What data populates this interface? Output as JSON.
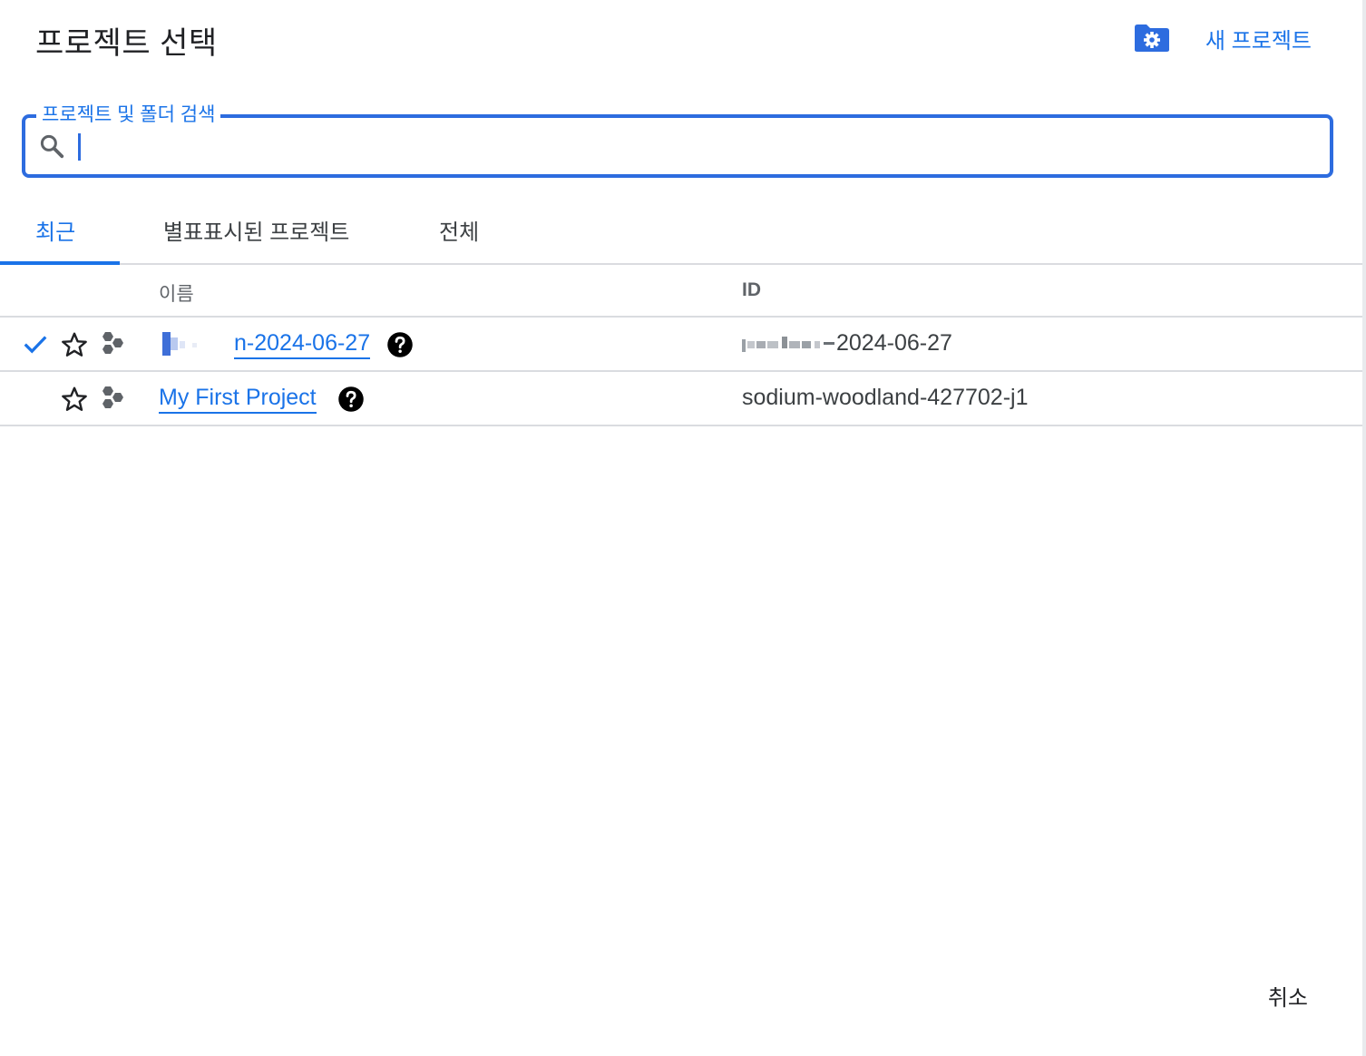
{
  "dialog": {
    "title": "프로젝트 선택",
    "folder_settings_icon": "folder-gear-icon",
    "new_project_label": "새 프로젝트"
  },
  "search": {
    "label": "프로젝트 및 폴더 검색",
    "value": "",
    "icon": "search-icon"
  },
  "tabs": [
    {
      "label": "최근",
      "active": true
    },
    {
      "label": "별표표시된 프로젝트",
      "active": false
    },
    {
      "label": "전체",
      "active": false
    }
  ],
  "table": {
    "columns": {
      "name": "이름",
      "id": "ID"
    },
    "rows": [
      {
        "selected": true,
        "name_visible": "n-2024-06-27",
        "id_visible": "2024-06-27"
      },
      {
        "selected": false,
        "name_visible": "My First Project",
        "id_visible": "sodium-woodland-427702-j1"
      }
    ]
  },
  "footer": {
    "cancel_label": "취소"
  },
  "colors": {
    "accent": "#1a73e8",
    "search_border": "#2d6cdf",
    "divider": "#dadce0"
  }
}
